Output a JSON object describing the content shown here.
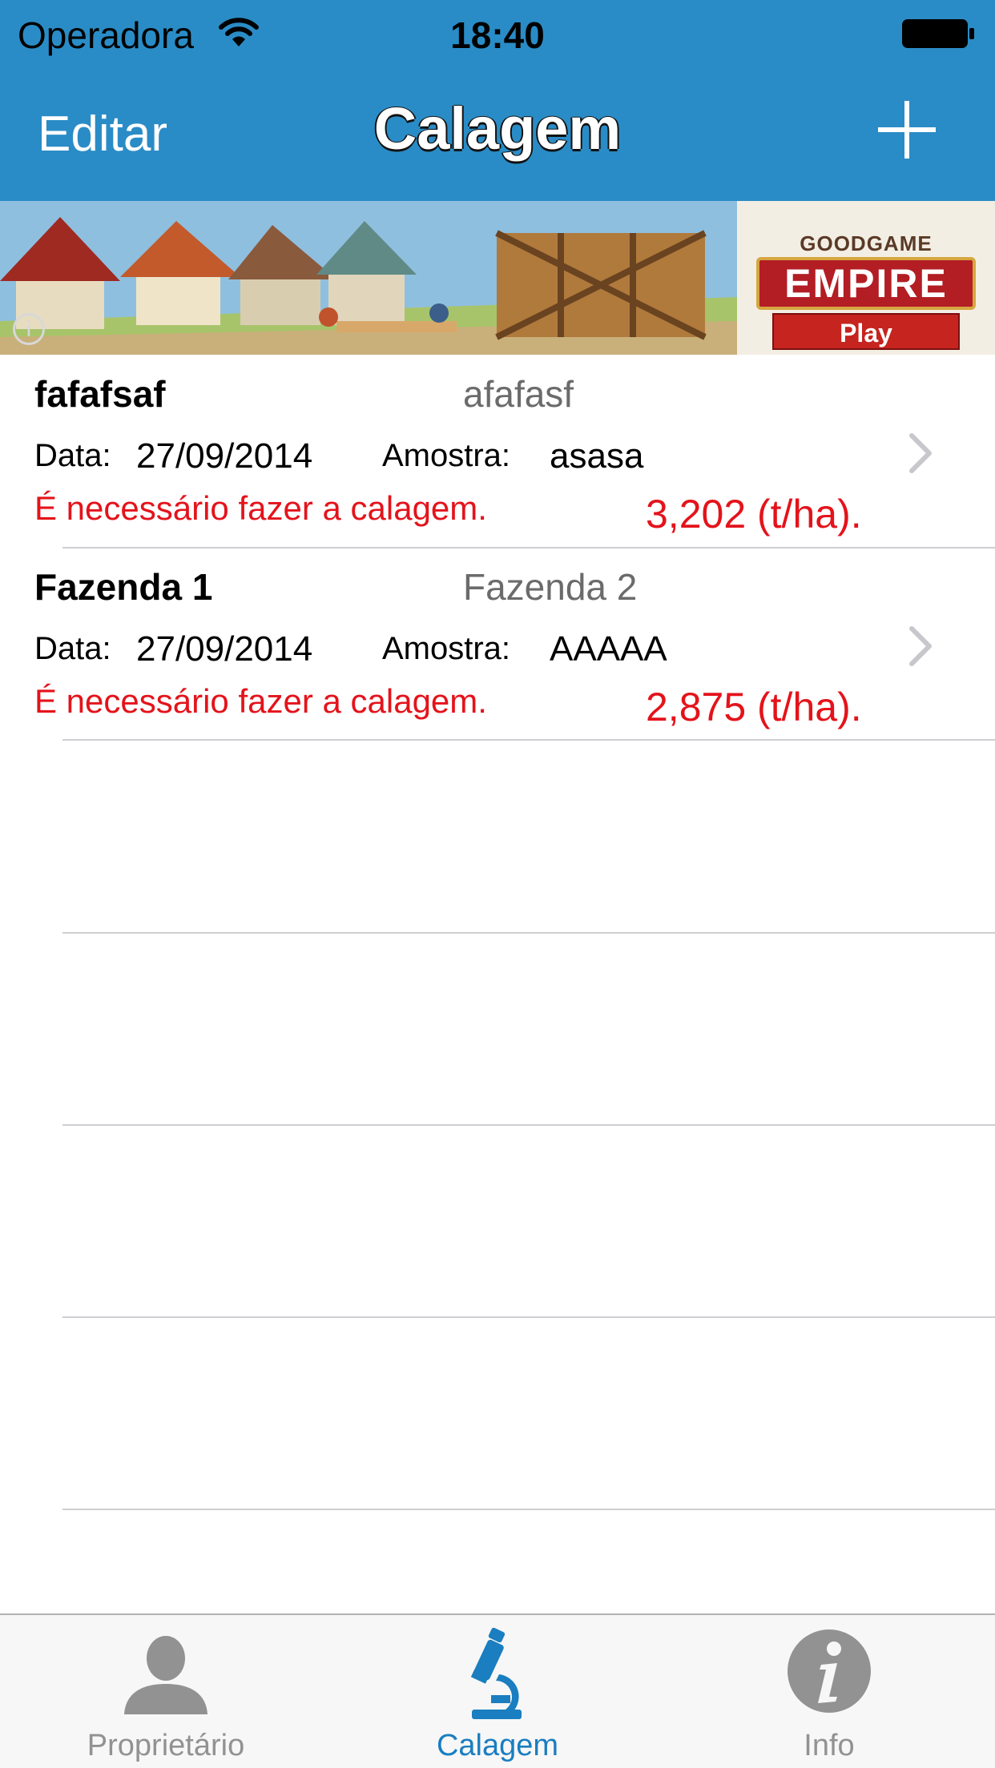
{
  "status_bar": {
    "carrier": "Operadora",
    "time": "18:40"
  },
  "nav_bar": {
    "edit_label": "Editar",
    "title": "Calagem",
    "add_icon": "plus-icon"
  },
  "ad": {
    "brand_small": "GOODGAME",
    "brand_big": "EMPIRE",
    "play_label": "Play",
    "info_icon": "info-icon"
  },
  "list": {
    "items": [
      {
        "title": "fafafsaf",
        "subtitle": "afafasf",
        "date_label": "Data:",
        "date": "27/09/2014",
        "sample_label": "Amostra:",
        "sample": "asasa",
        "warning": "É necessário fazer a calagem.",
        "amount": "3,202 (t/ha)."
      },
      {
        "title": "Fazenda 1",
        "subtitle": "Fazenda 2",
        "date_label": "Data:",
        "date": "27/09/2014",
        "sample_label": "Amostra:",
        "sample": "AAAAA",
        "warning": "É necessário fazer a calagem.",
        "amount": "2,875 (t/ha)."
      }
    ]
  },
  "tab_bar": {
    "tabs": [
      {
        "label": "Proprietário",
        "icon": "person-icon",
        "selected": false
      },
      {
        "label": "Calagem",
        "icon": "microscope-icon",
        "selected": true
      },
      {
        "label": "Info",
        "icon": "info-icon",
        "selected": false
      }
    ]
  },
  "colors": {
    "nav_blue": "#2a8cc6",
    "warning_red": "#e4131b",
    "tab_selected": "#1a7ec0",
    "tab_unselected": "#929292"
  }
}
